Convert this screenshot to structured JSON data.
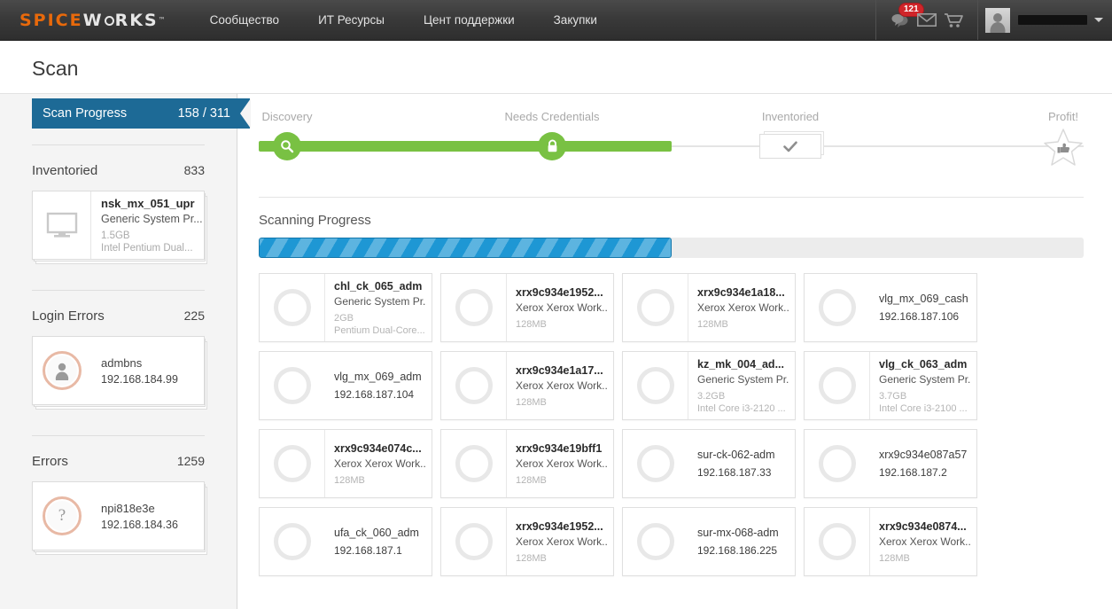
{
  "header": {
    "logo": {
      "part1": "SPICE",
      "part2": "W",
      "part3": "RKS",
      "tm": "™"
    },
    "nav": [
      {
        "label": "Сообщество"
      },
      {
        "label": "ИТ Ресурсы"
      },
      {
        "label": "Цент поддержки"
      },
      {
        "label": "Закупки"
      }
    ],
    "notifications_badge": "121",
    "icons": [
      "chat-icon",
      "envelope-icon",
      "cart-icon"
    ],
    "username": ""
  },
  "page": {
    "title": "Scan"
  },
  "sidebar": {
    "scan_progress": {
      "label": "Scan Progress",
      "count": "158 / 311"
    },
    "sections": [
      {
        "name": "Inventoried",
        "count": "833",
        "card": {
          "icon": "monitor-icon",
          "name": "nsk_mx_051_upr",
          "type": "Generic System Pr...",
          "spec1": "1.5GB",
          "spec2": "Intel Pentium Dual..."
        }
      },
      {
        "name": "Login Errors",
        "count": "225",
        "card": {
          "icon": "person-icon",
          "name": "admbns",
          "ip": "192.168.184.99"
        }
      },
      {
        "name": "Errors",
        "count": "1259",
        "card": {
          "icon": "question-icon",
          "name": "npi818e3e",
          "ip": "192.168.184.36"
        }
      }
    ]
  },
  "stepper": {
    "steps": [
      {
        "label": "Discovery",
        "icon": "magnifier-icon",
        "state": "done"
      },
      {
        "label": "Needs Credentials",
        "icon": "lock-icon",
        "state": "done"
      },
      {
        "label": "Inventoried",
        "icon": "check-icon",
        "state": "pending"
      },
      {
        "label": "Profit!",
        "icon": "star-thumbsup-icon",
        "state": "pending"
      }
    ]
  },
  "scanning": {
    "heading": "Scanning Progress",
    "percent": 50
  },
  "devices": [
    {
      "name": "chl_ck_065_adm",
      "bold": true,
      "divider": true,
      "type": "Generic System Pr...",
      "spec1": "2GB",
      "spec2": "Pentium Dual-Core..."
    },
    {
      "name": "xrx9c934e1952...",
      "bold": true,
      "divider": true,
      "type": "Xerox Xerox Work...",
      "spec1": "128MB"
    },
    {
      "name": "xrx9c934e1a18...",
      "bold": true,
      "divider": true,
      "type": "Xerox Xerox Work...",
      "spec1": "128MB"
    },
    {
      "name": "vlg_mx_069_cash",
      "bold": false,
      "divider": false,
      "ip": "192.168.187.106"
    },
    {
      "name": "vlg_mx_069_adm",
      "bold": false,
      "divider": false,
      "ip": "192.168.187.104"
    },
    {
      "name": "xrx9c934e1a17...",
      "bold": true,
      "divider": true,
      "type": "Xerox Xerox Work...",
      "spec1": "128MB"
    },
    {
      "name": "kz_mk_004_ad...",
      "bold": true,
      "divider": true,
      "type": "Generic System Pr...",
      "spec1": "3.2GB",
      "spec2": "Intel Core i3-2120 ..."
    },
    {
      "name": "vlg_ck_063_adm",
      "bold": true,
      "divider": true,
      "type": "Generic System Pr...",
      "spec1": "3.7GB",
      "spec2": "Intel Core i3-2100 ..."
    },
    {
      "name": "xrx9c934e074c...",
      "bold": true,
      "divider": true,
      "type": "Xerox Xerox Work...",
      "spec1": "128MB"
    },
    {
      "name": "xrx9c934e19bff1",
      "bold": true,
      "divider": true,
      "type": "Xerox Xerox Work...",
      "spec1": "128MB"
    },
    {
      "name": "sur-ck-062-adm",
      "bold": false,
      "divider": false,
      "ip": "192.168.187.33"
    },
    {
      "name": "xrx9c934e087a57",
      "bold": false,
      "divider": false,
      "ip": "192.168.187.2"
    },
    {
      "name": "ufa_ck_060_adm",
      "bold": false,
      "divider": false,
      "ip": "192.168.187.1"
    },
    {
      "name": "xrx9c934e1952...",
      "bold": true,
      "divider": true,
      "type": "Xerox Xerox Work...",
      "spec1": "128MB"
    },
    {
      "name": "sur-mx-068-adm",
      "bold": false,
      "divider": false,
      "ip": "192.168.186.225"
    },
    {
      "name": "xrx9c934e0874...",
      "bold": true,
      "divider": true,
      "type": "Xerox Xerox Work...",
      "spec1": "128MB"
    }
  ],
  "colors": {
    "accent_blue": "#1d6a96",
    "progress_blue": "#1e97d4",
    "step_green": "#79c143",
    "badge_red": "#d0252a",
    "logo_orange": "#e8690b"
  }
}
